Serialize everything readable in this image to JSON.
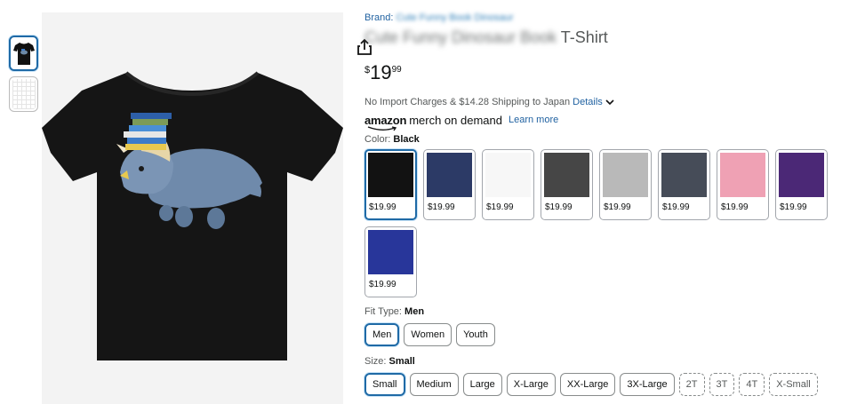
{
  "brand": {
    "prefix": "Brand: ",
    "name": "Cute Funny Book Dinosaur"
  },
  "title": {
    "blurred": "Cute Funny Dinosaur Book",
    "suffix": " T-Shirt"
  },
  "price": {
    "symbol": "$",
    "whole": "19",
    "fraction": "99"
  },
  "shipping": {
    "text": "No Import Charges & $14.28 Shipping to Japan",
    "details_link": "Details"
  },
  "merch": {
    "logo_word": "amazon",
    "tagline": "merch on demand",
    "learn_more": "Learn more"
  },
  "color": {
    "label": "Color: ",
    "selected": "Black",
    "options": [
      {
        "price": "$19.99",
        "hex": "#121212"
      },
      {
        "price": "$19.99",
        "hex": "#2c3a66"
      },
      {
        "price": "$19.99",
        "hex": "#f7f7f7"
      },
      {
        "price": "$19.99",
        "hex": "#464646"
      },
      {
        "price": "$19.99",
        "hex": "#b9b9b9"
      },
      {
        "price": "$19.99",
        "hex": "#464c58"
      },
      {
        "price": "$19.99",
        "hex": "#efa1b4"
      },
      {
        "price": "$19.99",
        "hex": "#4b2876"
      },
      {
        "price": "$19.99",
        "hex": "#28369a"
      }
    ]
  },
  "fit": {
    "label": "Fit Type: ",
    "selected": "Men",
    "options": [
      "Men",
      "Women",
      "Youth"
    ]
  },
  "size": {
    "label": "Size: ",
    "selected": "Small",
    "options": [
      "Small",
      "Medium",
      "Large",
      "X-Large",
      "XX-Large",
      "3X-Large",
      "2T",
      "3T",
      "4T",
      "X-Small"
    ]
  }
}
